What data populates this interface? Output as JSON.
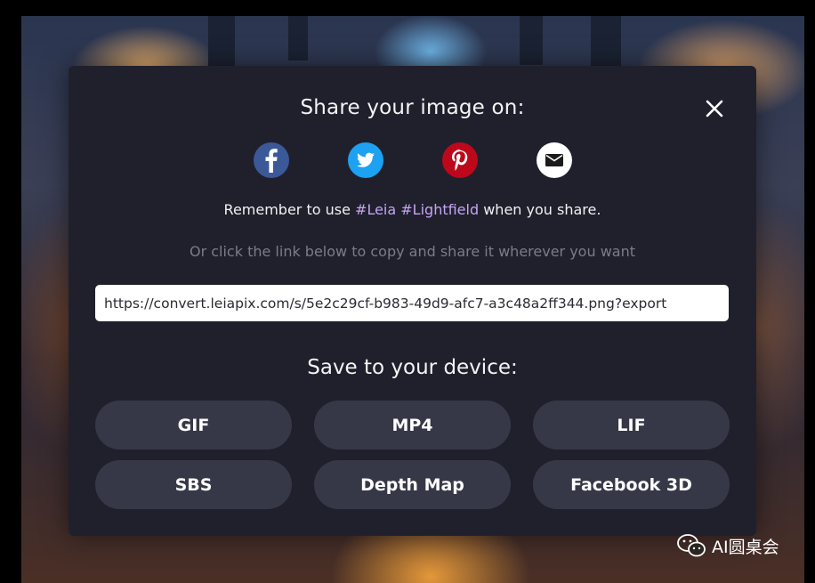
{
  "modal": {
    "title": "Share your image on:",
    "social_icons": [
      "facebook-icon",
      "twitter-icon",
      "pinterest-icon",
      "email-icon"
    ],
    "remember_prefix": "Remember to use ",
    "hashtag_1": "#Leia",
    "hashtag_space": " ",
    "hashtag_2": "#Lightfield",
    "remember_suffix": " when you share.",
    "hint": "Or click the link below to copy and share it wherever you want",
    "share_link": "https://convert.leiapix.com/s/5e2c29cf-b983-49d9-afc7-a3c48a2ff344.png?export",
    "save_title": "Save to your device:",
    "buttons": [
      "GIF",
      "MP4",
      "LIF",
      "SBS",
      "Depth Map",
      "Facebook 3D"
    ]
  },
  "colors": {
    "facebook": "#3b5998",
    "twitter": "#1da1f2",
    "pinterest": "#bd081c",
    "email": "#ffffff",
    "modal_bg": "#20202c",
    "button_bg": "#373847",
    "hashtag": "#c6a4f5"
  },
  "watermark": {
    "icon": "wechat-icon",
    "text": "AI圆桌会"
  }
}
